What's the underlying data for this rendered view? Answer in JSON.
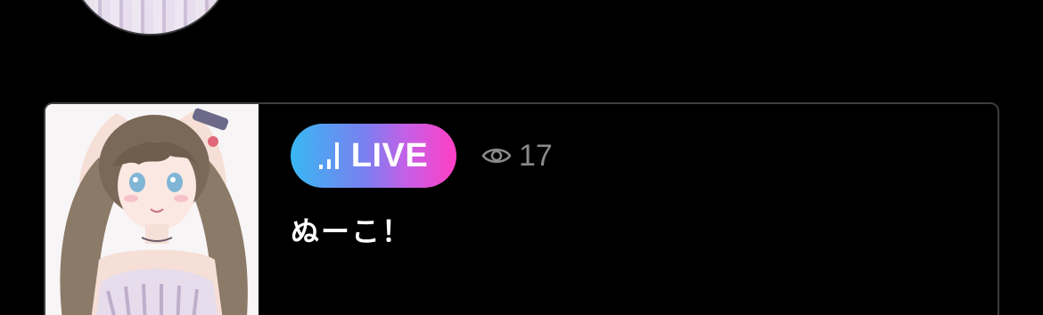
{
  "previous_item": {
    "avatar_icon": "streamer-avatar"
  },
  "live_card": {
    "thumbnail_icon": "streamer-thumbnail",
    "badge": {
      "icon": "signal-bars-icon",
      "label": "LIVE",
      "gradient": [
        "#38b8f2",
        "#ff3fc4"
      ]
    },
    "viewers": {
      "icon": "eye-icon",
      "count": "17"
    },
    "title": "ぬーこ！"
  },
  "colors": {
    "background": "#000000",
    "card_border": "#3d3d3d",
    "muted_text": "#8a8a8a",
    "text": "#ffffff"
  }
}
